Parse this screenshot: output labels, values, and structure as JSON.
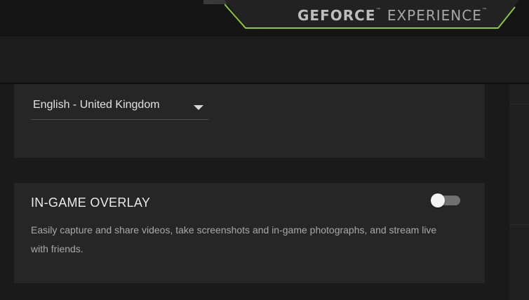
{
  "app": {
    "brand_bold": "GEFORCE",
    "brand_light": "EXPERIENCE",
    "trademark": "™"
  },
  "language": {
    "selected": "English - United Kingdom"
  },
  "overlay": {
    "title": "IN-GAME OVERLAY",
    "description": "Easily capture and share videos, take screenshots and in-game photographs, and stream live with friends.",
    "toggle_on": false
  },
  "colors": {
    "accent": "#76b900",
    "panel": "#262626",
    "background": "#1a1a1a"
  }
}
